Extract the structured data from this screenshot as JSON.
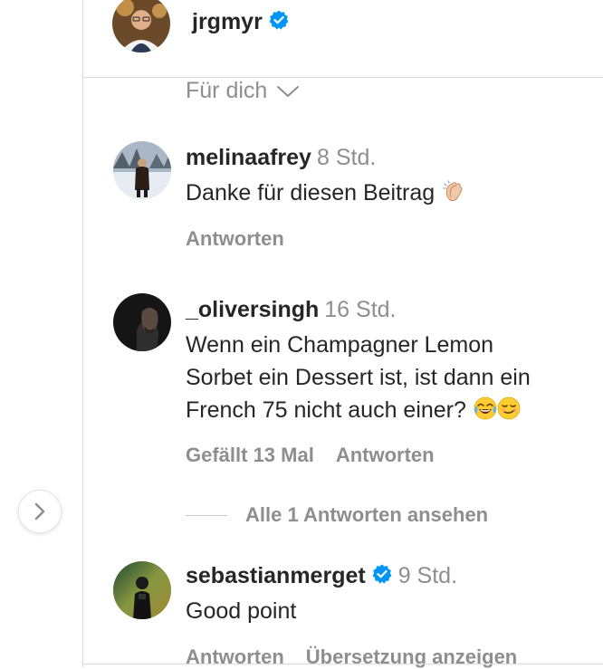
{
  "post": {
    "author": "jrgmyr",
    "verified": true
  },
  "sort": {
    "label": "Für dich"
  },
  "comments": [
    {
      "username": "melinaafrey",
      "time": "8 Std.",
      "text": "Danke für diesen Beitrag",
      "emoji": "clapping-hands-emoji",
      "reply": "Antworten"
    },
    {
      "username": "_oliversingh",
      "time": "16 Std.",
      "text_lines": [
        "Wenn ein Champagner Lemon",
        "Sorbet ein Dessert ist, ist dann ein",
        "French 75 nicht auch einer?"
      ],
      "emojis": [
        "tears-of-joy-emoji",
        "smirking-face-emoji"
      ],
      "likes": "Gefällt 13 Mal",
      "reply": "Antworten",
      "view_replies": "Alle 1 Antworten ansehen"
    },
    {
      "username": "sebastianmerget",
      "verified": true,
      "time": "9 Std.",
      "text": "Good point",
      "reply": "Antworten",
      "translate": "Übersetzung anzeigen"
    }
  ],
  "colors": {
    "text": "#262626",
    "muted": "#8e8e8e",
    "verified_blue": "#0095f6",
    "border": "#dbdbdb"
  }
}
